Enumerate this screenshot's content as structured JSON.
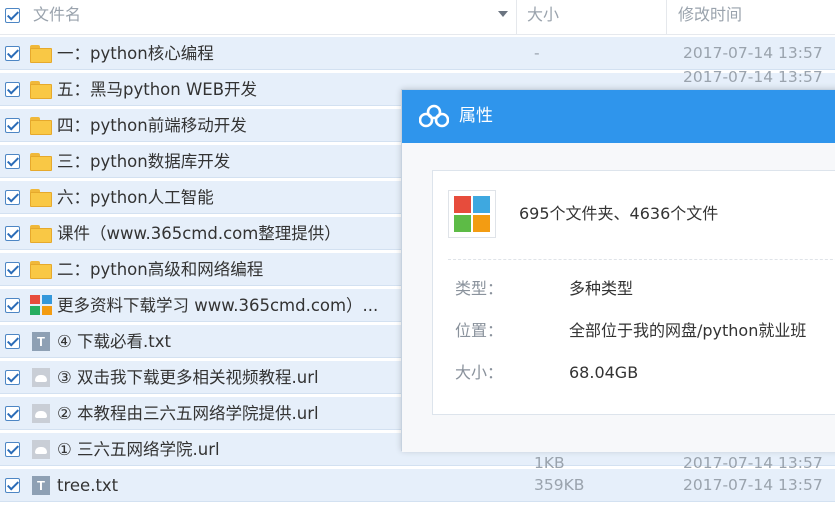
{
  "header": {
    "name_col": "文件名",
    "size_col": "大小",
    "time_col": "修改时间"
  },
  "rows": [
    {
      "name": "一：python核心编程",
      "size": "-",
      "date": "2017-07-14 13:57",
      "icon": "folder-icon"
    },
    {
      "name": "五：黑马python WEB开发",
      "size": "",
      "date": "2017-07-14 13:57",
      "icon": "folder-icon"
    },
    {
      "name": "四：python前端移动开发",
      "size": "",
      "date": "",
      "icon": "folder-icon"
    },
    {
      "name": "三：python数据库开发",
      "size": "",
      "date": "",
      "icon": "folder-icon"
    },
    {
      "name": "六：python人工智能",
      "size": "",
      "date": "",
      "icon": "folder-icon"
    },
    {
      "name": "课件（www.365cmd.com整理提供）",
      "size": "",
      "date": "",
      "icon": "folder-icon"
    },
    {
      "name": "二：python高级和网络编程",
      "size": "",
      "date": "",
      "icon": "folder-icon"
    },
    {
      "name": "更多资料下载学习 www.365cmd.com）...",
      "size": "",
      "date": "",
      "icon": "archive-icon"
    },
    {
      "name": "④ 下载必看.txt",
      "size": "",
      "date": "",
      "icon": "txt-file-icon"
    },
    {
      "name": "③ 双击我下载更多相关视频教程.url",
      "size": "",
      "date": "",
      "icon": "url-file-icon"
    },
    {
      "name": "② 本教程由三六五网络学院提供.url",
      "size": "",
      "date": "",
      "icon": "url-file-icon"
    },
    {
      "name": "① 三六五网络学院.url",
      "size": "1KB",
      "date": "2017-07-14 13:57",
      "icon": "url-file-icon"
    },
    {
      "name": "tree.txt",
      "size": "359KB",
      "date": "2017-07-14 13:57",
      "icon": "txt-file-icon"
    }
  ],
  "dialog": {
    "title": "属性",
    "summary": "695个文件夹、4636个文件",
    "type_label": "类型：",
    "type_value": "多种类型",
    "location_label": "位置：",
    "location_value": "全部位于我的网盘/python就业班",
    "size_label": "大小：",
    "size_value": "68.04GB"
  },
  "colors": {
    "row_selected": "#e6effa",
    "dialog_title": "#2f95ec",
    "folder": "#f9c845"
  }
}
